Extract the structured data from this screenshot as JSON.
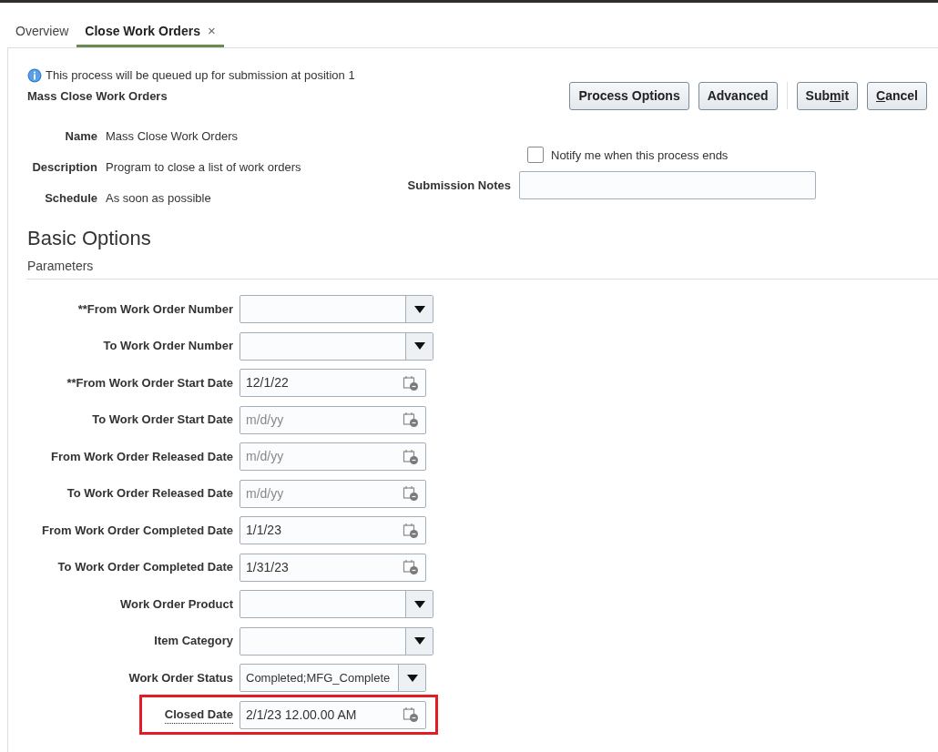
{
  "tabs": [
    {
      "label": "Overview",
      "selected": false,
      "closable": false
    },
    {
      "label": "Close Work Orders",
      "selected": true,
      "closable": true,
      "close_icon": "×"
    }
  ],
  "info_message": "This process will be queued up for submission at position 1",
  "process_title": "Mass Close Work Orders",
  "buttons": [
    {
      "label": "Process Options"
    },
    {
      "label": "Advanced"
    },
    {
      "label_before": "Sub",
      "access_key": "m",
      "label_after": "it"
    },
    {
      "access_key": "C",
      "label_after": "ancel"
    }
  ],
  "details": [
    {
      "label": "Name",
      "value": "Mass Close Work Orders"
    },
    {
      "label": "Description",
      "value": "Program to close a list of work orders"
    },
    {
      "label": "Schedule",
      "value": "As soon as possible"
    }
  ],
  "notify": {
    "label": "Notify me when this process ends",
    "checked": false
  },
  "submission_notes": {
    "label": "Submission Notes"
  },
  "section_title": "Basic Options",
  "subsection_title": "Parameters",
  "parameters": [
    {
      "kind": "select",
      "label": "**From Work Order Number",
      "highlighted": false
    },
    {
      "kind": "select",
      "label": "To Work Order Number",
      "highlighted": false
    },
    {
      "kind": "date",
      "label": "**From Work Order Start Date",
      "value": "12/1/22",
      "highlighted": false
    },
    {
      "kind": "date",
      "label": "To Work Order Start Date",
      "placeholder": "m/d/yy",
      "highlighted": false
    },
    {
      "kind": "date",
      "label": "From Work Order Released Date",
      "placeholder": "m/d/yy",
      "highlighted": false
    },
    {
      "kind": "date",
      "label": "To Work Order Released Date",
      "placeholder": "m/d/yy",
      "highlighted": false
    },
    {
      "kind": "date",
      "label": "From Work Order Completed Date",
      "value": "1/1/23",
      "highlighted": false
    },
    {
      "kind": "date",
      "label": "To Work Order Completed Date",
      "value": "1/31/23",
      "highlighted": false
    },
    {
      "kind": "select",
      "label": "Work Order Product",
      "highlighted": false
    },
    {
      "kind": "select",
      "label": "Item Category",
      "highlighted": false
    },
    {
      "kind": "select",
      "label": "Work Order Status",
      "value": "Completed;MFG_Complete",
      "highlighted": false
    },
    {
      "kind": "date",
      "label": "Closed Date",
      "value": "2/1/23 12.00.00 AM",
      "highlighted": true,
      "dotted_label": true
    }
  ]
}
